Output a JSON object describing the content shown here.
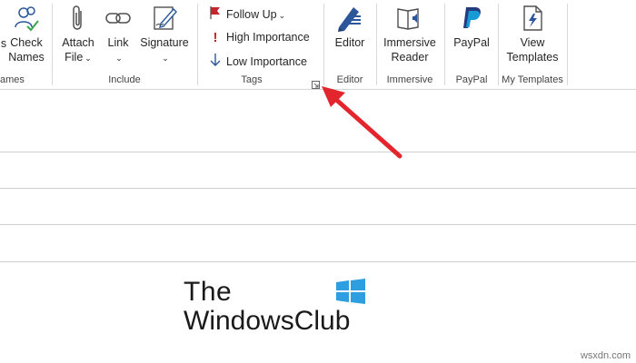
{
  "ribbon": {
    "groups": {
      "names": {
        "label": "ames",
        "check_names": "Check\nNames",
        "check_line1": "Check",
        "check_line2": "Names",
        "left_fragment": "s"
      },
      "include": {
        "label": "Include",
        "attach_line1": "Attach",
        "attach_line2": "File",
        "link": "Link",
        "signature": "Signature"
      },
      "tags": {
        "label": "Tags",
        "follow_up": "Follow Up",
        "high_importance": "High Importance",
        "low_importance": "Low Importance"
      },
      "editor": {
        "label": "Editor",
        "editor": "Editor"
      },
      "immersive": {
        "label": "Immersive",
        "reader_line1": "Immersive",
        "reader_line2": "Reader"
      },
      "paypal": {
        "label": "PayPal",
        "paypal": "PayPal"
      },
      "my_templates": {
        "label": "My Templates",
        "view_line1": "View",
        "view_line2": "Templates"
      }
    }
  },
  "logo": {
    "line1": "The",
    "line2": "WindowsClub"
  },
  "watermark": "wsxdn.com",
  "colors": {
    "accent": "#2b579a",
    "arrow": "#e3262e",
    "flag": "#c4262e"
  }
}
